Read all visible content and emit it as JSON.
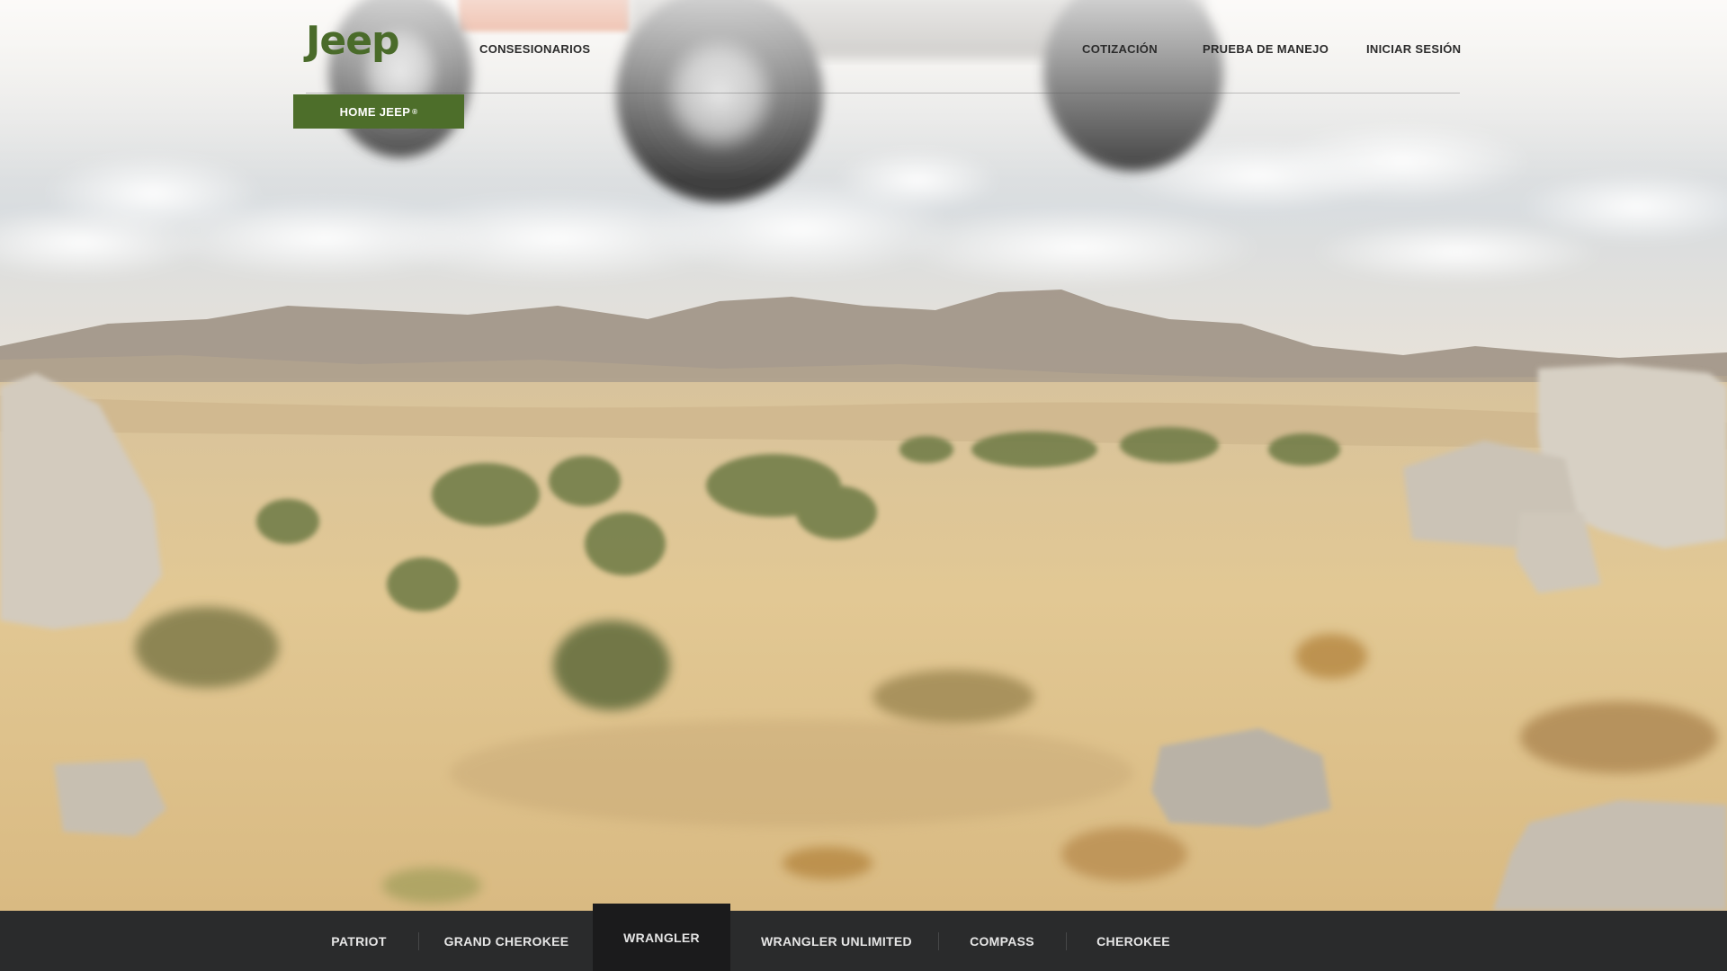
{
  "brand": {
    "logo_text": "Jeep"
  },
  "header": {
    "nav": {
      "dealers": "CONSESIONARIOS",
      "quote": "COTIZACIÓN",
      "test_drive": "PRUEBA DE MANEJO",
      "login": "INICIAR SESIÓN"
    },
    "home_tab": {
      "label": "HOME JEEP",
      "mark": "®"
    }
  },
  "models": {
    "active": "WRANGLER",
    "items": [
      "PATRIOT",
      "GRAND CHEROKEE",
      "WRANGLER",
      "WRANGLER UNLIMITED",
      "COMPASS",
      "CHEROKEE"
    ]
  },
  "colors": {
    "brand_green": "#4d6e2a",
    "bar_bg": "#2a2b2c",
    "bar_active": "#1b1b1c"
  }
}
